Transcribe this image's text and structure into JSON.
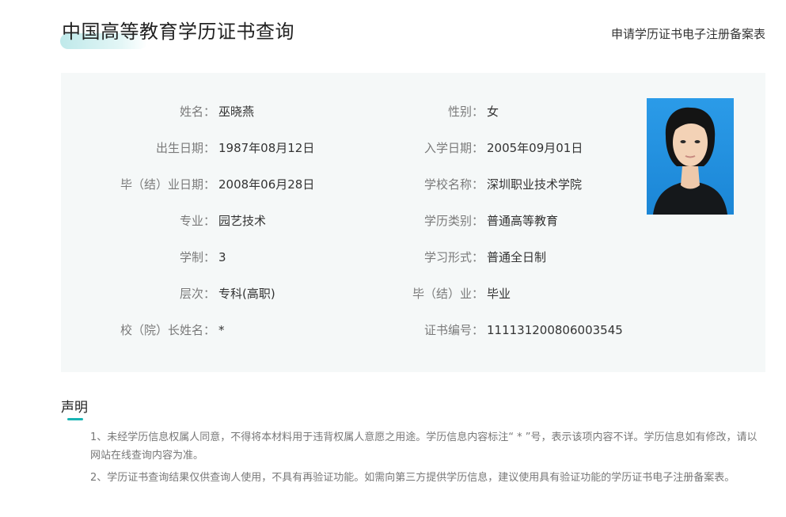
{
  "header": {
    "title": "中国高等教育学历证书查询",
    "link": "申请学历证书电子注册备案表"
  },
  "colon": "：",
  "fields_left": [
    {
      "label": "姓名",
      "value": "巫晓燕"
    },
    {
      "label": "出生日期",
      "value": "1987年08月12日"
    },
    {
      "label": "毕（结）业日期",
      "value": "2008年06月28日"
    },
    {
      "label": "专业",
      "value": "园艺技术"
    },
    {
      "label": "学制",
      "value": "3"
    },
    {
      "label": "层次",
      "value": "专科(高职)"
    },
    {
      "label": "校（院）长姓名",
      "value": "*"
    }
  ],
  "fields_right": [
    {
      "label": "性别",
      "value": "女"
    },
    {
      "label": "入学日期",
      "value": "2005年09月01日"
    },
    {
      "label": "学校名称",
      "value": "深圳职业技术学院"
    },
    {
      "label": "学历类别",
      "value": "普通高等教育"
    },
    {
      "label": "学习形式",
      "value": "普通全日制"
    },
    {
      "label": "毕（结）业",
      "value": "毕业"
    },
    {
      "label": "证书编号",
      "value": "111131200806003545"
    }
  ],
  "photo": {
    "background": "#1f8fe0",
    "icon": "student-photo"
  },
  "notice": {
    "title": "声明",
    "items": [
      "1、未经学历信息权属人同意，不得将本材料用于违背权属人意愿之用途。学历信息内容标注“ * ”号，表示该项内容不详。学历信息如有修改，请以网站在线查询内容为准。",
      "2、学历证书查询结果仅供查询人使用，不具有再验证功能。如需向第三方提供学历信息，建议使用具有验证功能的学历证书电子注册备案表。"
    ]
  },
  "colors": {
    "accent": "#19b4b4",
    "panel": "#f5f8f8",
    "label": "#7a7a7a"
  }
}
